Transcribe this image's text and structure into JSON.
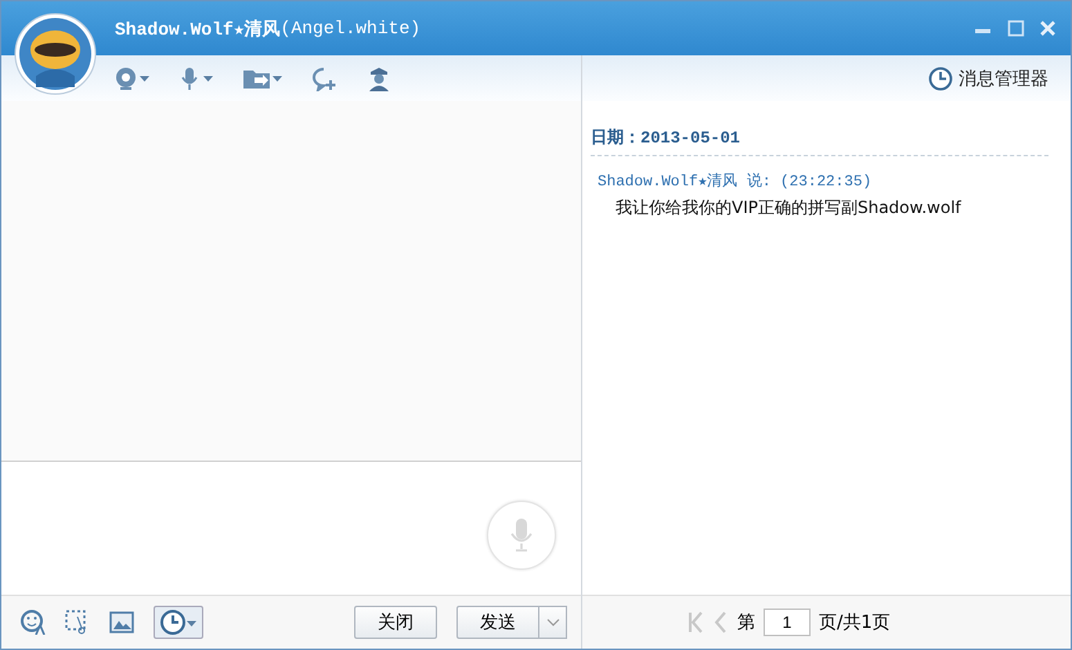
{
  "window": {
    "title": "Shadow.Wolf★清风",
    "subtitle": "(Angel.white)"
  },
  "history": {
    "manager_label": "消息管理器",
    "date_line": "日期：2013-05-01",
    "messages": [
      {
        "header": "Shadow.Wolf★清风 说: (23:22:35)",
        "text": "我让你给我你的VIP正确的拼写副Shadow.wolf"
      }
    ]
  },
  "compose": {
    "buttons": [
      "关闭",
      "发送"
    ]
  },
  "pager": {
    "prefix": "第",
    "page": "1",
    "suffix": "页/共1页"
  }
}
